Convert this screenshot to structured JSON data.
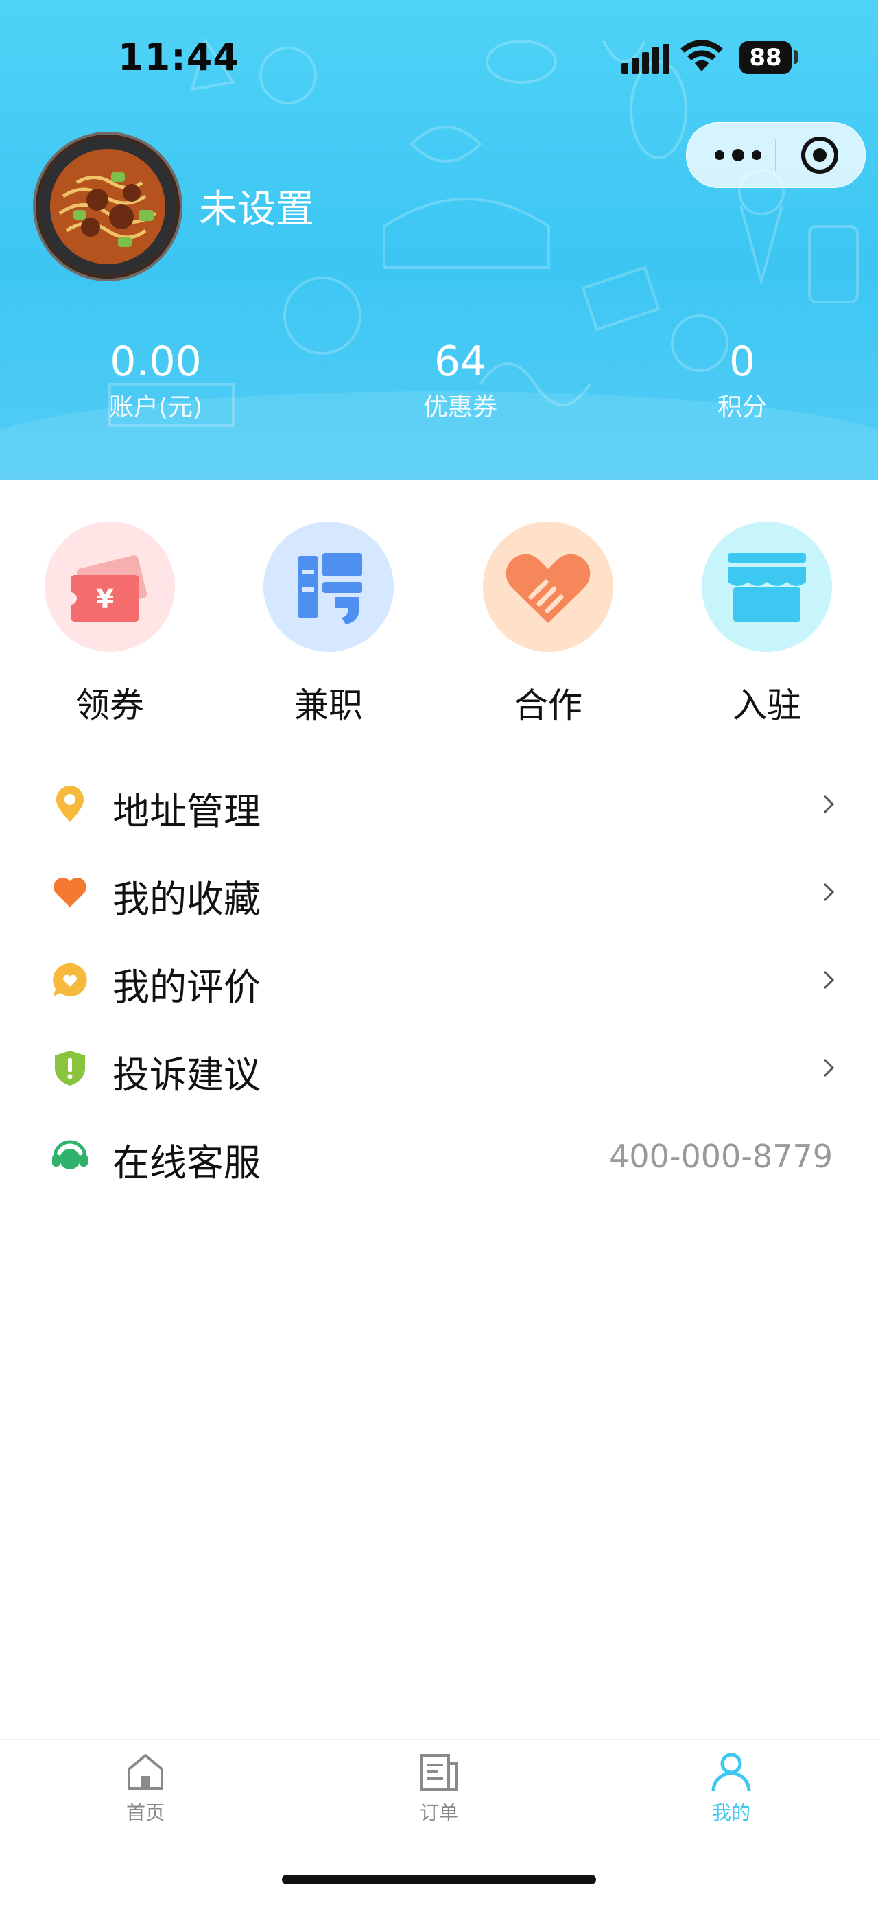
{
  "status": {
    "time": "11:44",
    "battery": "88"
  },
  "profile": {
    "nickname": "未设置"
  },
  "stats": [
    {
      "value": "0.00",
      "label": "账户(元)"
    },
    {
      "value": "64",
      "label": "优惠券"
    },
    {
      "value": "0",
      "label": "积分"
    }
  ],
  "quick_actions": [
    {
      "label": "领券",
      "icon": "coupon-icon",
      "color": "#ffe5e5"
    },
    {
      "label": "兼职",
      "icon": "recruit-icon",
      "color": "#d6e8ff"
    },
    {
      "label": "合作",
      "icon": "handshake-icon",
      "color": "#ffe0c8"
    },
    {
      "label": "入驻",
      "icon": "store-icon",
      "color": "#c8f4fb"
    }
  ],
  "menu": [
    {
      "label": "地址管理",
      "icon": "location-icon"
    },
    {
      "label": "我的收藏",
      "icon": "heart-icon"
    },
    {
      "label": "我的评价",
      "icon": "comment-icon"
    },
    {
      "label": "投诉建议",
      "icon": "shield-icon"
    },
    {
      "label": "在线客服",
      "icon": "headset-icon",
      "value": "400-000-8779"
    }
  ],
  "tabs": [
    {
      "label": "首页",
      "icon": "home-icon"
    },
    {
      "label": "订单",
      "icon": "order-icon"
    },
    {
      "label": "我的",
      "icon": "user-icon",
      "active": true
    }
  ],
  "colors": {
    "header": "#3dc6f3",
    "accent": "#3cc8f0"
  }
}
